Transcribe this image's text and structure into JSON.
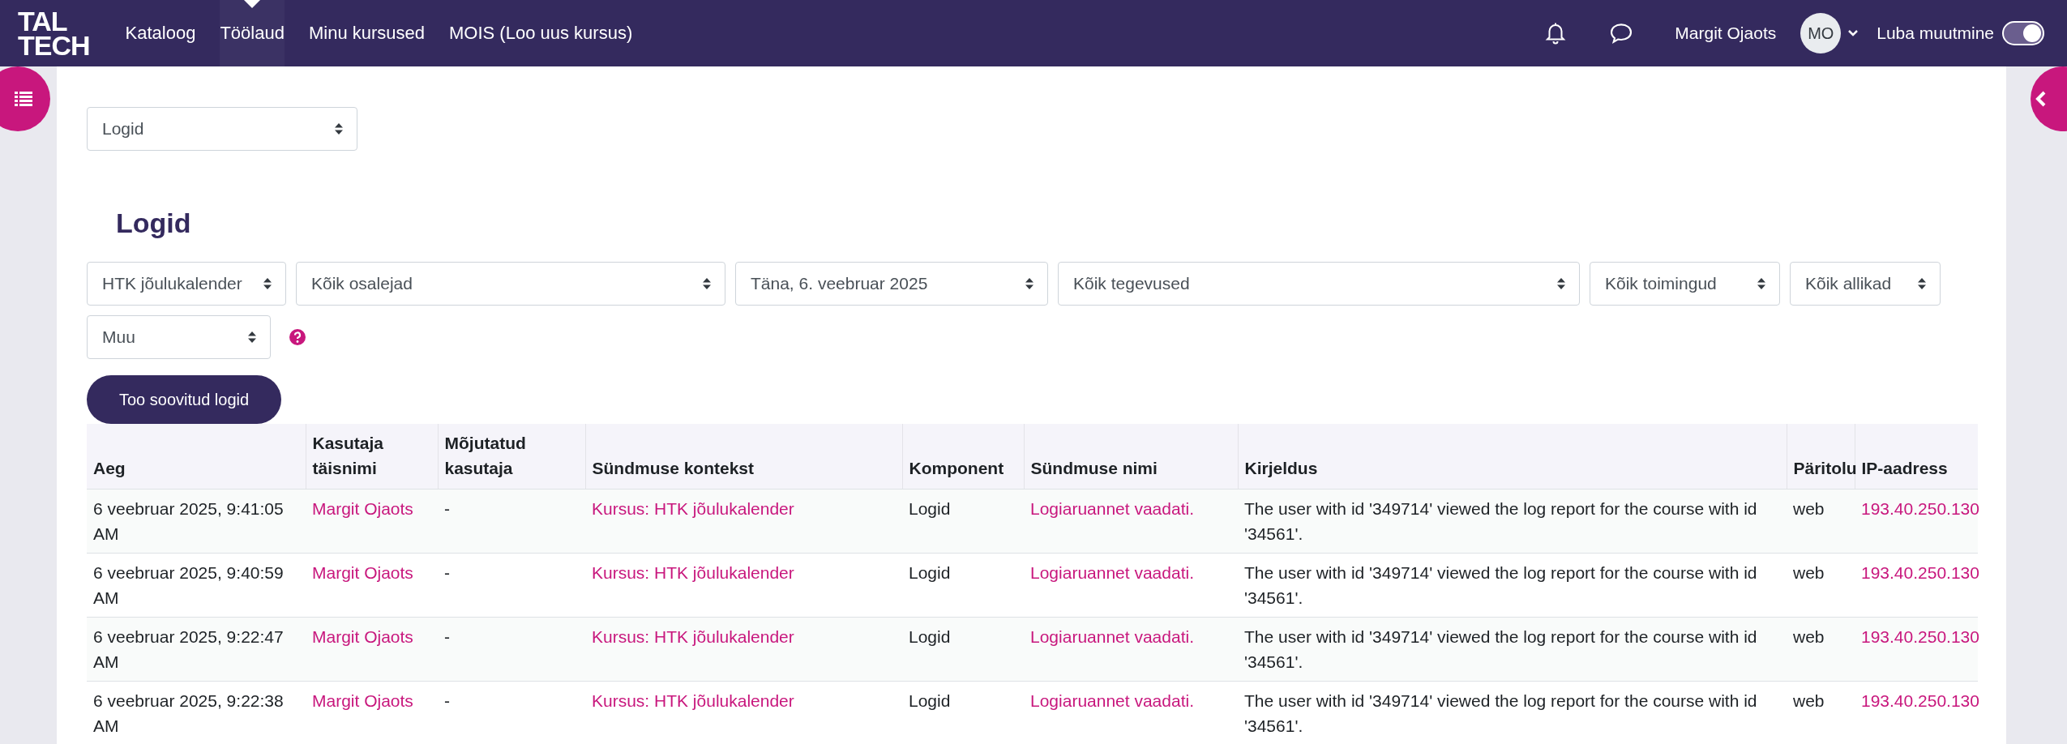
{
  "nav": {
    "logo": [
      "TAL",
      "TECH"
    ],
    "items": [
      {
        "label": "Kataloog",
        "selected": false
      },
      {
        "label": "Töölaud",
        "selected": true
      },
      {
        "label": "Minu kursused",
        "selected": false
      },
      {
        "label": "MOIS (Loo uus kursus)",
        "selected": false
      }
    ],
    "user_name": "Margit Ojaots",
    "avatar_initials": "MO",
    "edit_toggle": {
      "label": "Luba muutmine",
      "on": true
    }
  },
  "report_select": {
    "value": "Logid"
  },
  "heading": "Logid",
  "filters": [
    {
      "value": "HTK jõulukalender"
    },
    {
      "value": "Kõik osalejad"
    },
    {
      "value": "Täna, 6. veebruar 2025"
    },
    {
      "value": "Kõik tegevused"
    },
    {
      "value": "Kõik toimingud"
    },
    {
      "value": "Kõik allikad"
    },
    {
      "value": "Muu"
    }
  ],
  "submit_button": "Too soovitud logid",
  "table": {
    "columns": [
      {
        "label": "Aeg",
        "kind": "text"
      },
      {
        "label": "Kasutaja täisnimi",
        "kind": "link"
      },
      {
        "label": "Mõjutatud kasutaja",
        "kind": "text"
      },
      {
        "label": "Sündmuse kontekst",
        "kind": "link"
      },
      {
        "label": "Komponent",
        "kind": "text"
      },
      {
        "label": "Sündmuse nimi",
        "kind": "link"
      },
      {
        "label": "Kirjeldus",
        "kind": "text"
      },
      {
        "label": "Päritolu",
        "kind": "text"
      },
      {
        "label": "IP-aadress",
        "kind": "link"
      }
    ],
    "rows": [
      [
        "6 veebruar 2025, 9:41:05 AM",
        "Margit Ojaots",
        "-",
        "Kursus: HTK jõulukalender",
        "Logid",
        "Logiaruannet vaadati.",
        "The user with id '349714' viewed the log report for the course with id '34561'.",
        "web",
        "193.40.250.130"
      ],
      [
        "6 veebruar 2025, 9:40:59 AM",
        "Margit Ojaots",
        "-",
        "Kursus: HTK jõulukalender",
        "Logid",
        "Logiaruannet vaadati.",
        "The user with id '349714' viewed the log report for the course with id '34561'.",
        "web",
        "193.40.250.130"
      ],
      [
        "6 veebruar 2025, 9:22:47 AM",
        "Margit Ojaots",
        "-",
        "Kursus: HTK jõulukalender",
        "Logid",
        "Logiaruannet vaadati.",
        "The user with id '349714' viewed the log report for the course with id '34561'.",
        "web",
        "193.40.250.130"
      ],
      [
        "6 veebruar 2025, 9:22:38 AM",
        "Margit Ojaots",
        "-",
        "Kursus: HTK jõulukalender",
        "Logid",
        "Logiaruannet vaadati.",
        "The user with id '349714' viewed the log report for the course with id '34561'.",
        "web",
        "193.40.250.130"
      ]
    ]
  }
}
